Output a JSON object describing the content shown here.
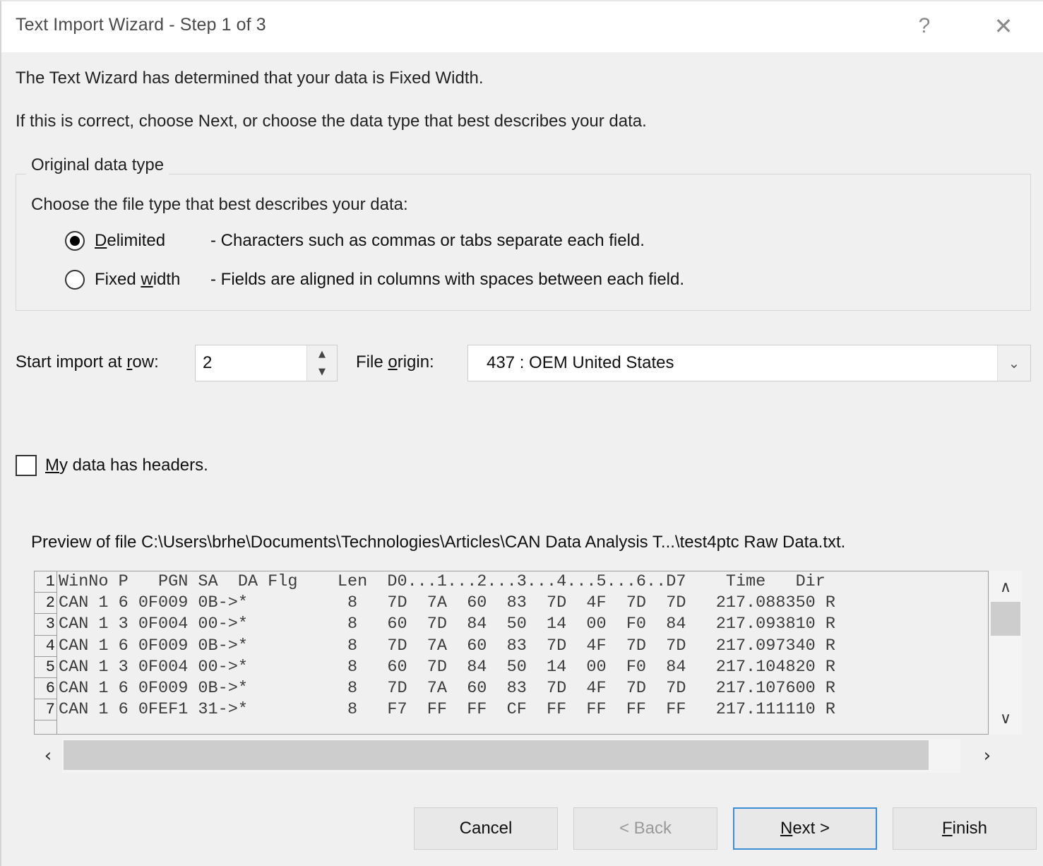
{
  "window": {
    "title": "Text Import Wizard - Step 1 of 3",
    "help_icon": "?",
    "close_icon": "✕"
  },
  "intro": {
    "line1": "The Text Wizard has determined that your data is Fixed Width.",
    "line2": "If this is correct, choose Next, or choose the data type that best describes your data."
  },
  "original_data_type": {
    "legend": "Original data type",
    "instruction": "Choose the file type that best describes your data:",
    "options": [
      {
        "label_prefix": "D",
        "label_rest": "elimited",
        "description": "- Characters such as commas or tabs separate each field.",
        "selected": true
      },
      {
        "label_prefix": "Fixed ",
        "label_mnemonic": "w",
        "label_rest": "idth",
        "description": "- Fields are aligned in columns with spaces between each field.",
        "selected": false
      }
    ]
  },
  "start_import": {
    "label_a": "Start import at ",
    "label_mnemonic": "r",
    "label_b": "ow:",
    "value": "2",
    "spinner_up": "▲",
    "spinner_down": "▼"
  },
  "file_origin": {
    "label_a": "File ",
    "label_mnemonic": "o",
    "label_b": "rigin:",
    "value": "437 : OEM United States",
    "arrow_icon": "⌄"
  },
  "headers_checkbox": {
    "label_mnemonic": "M",
    "label_rest": "y data has headers.",
    "checked": false
  },
  "preview": {
    "label": "Preview of file C:\\Users\\brhe\\Documents\\Technologies\\Articles\\CAN Data Analysis T...\\test4ptc Raw Data.txt.",
    "row_numbers": [
      "1",
      "2",
      "3",
      "4",
      "5",
      "6",
      "7",
      ""
    ],
    "lines": [
      "WinNo P   PGN SA  DA Flg    Len  D0...1...2...3...4...5...6..D7    Time   Dir",
      "CAN 1 6 0F009 0B->*          8   7D  7A  60  83  7D  4F  7D  7D   217.088350 R",
      "CAN 1 3 0F004 00->*          8   60  7D  84  50  14  00  F0  84   217.093810 R",
      "CAN 1 6 0F009 0B->*          8   7D  7A  60  83  7D  4F  7D  7D   217.097340 R",
      "CAN 1 3 0F004 00->*          8   60  7D  84  50  14  00  F0  84   217.104820 R",
      "CAN 1 6 0F009 0B->*          8   7D  7A  60  83  7D  4F  7D  7D   217.107600 R",
      "CAN 1 6 0FEF1 31->*          8   F7  FF  FF  CF  FF  FF  FF  FF   217.111110 R"
    ],
    "vscroll_up_icon": "∧",
    "vscroll_down_icon": "∨",
    "hscroll_left_icon": "‹",
    "hscroll_right_icon": "›"
  },
  "footer": {
    "cancel": "Cancel",
    "back": "< Back",
    "next_mnemonic": "N",
    "next_rest": "ext >",
    "finish_mnemonic": "F",
    "finish_rest": "inish"
  },
  "colors": {
    "dialog_bg": "#f0f0f0",
    "titlebar_bg": "#ffffff",
    "focus_border": "#3b8ed6",
    "disabled_text": "#9a9a9a",
    "preview_bg": "#f0f0f0"
  }
}
